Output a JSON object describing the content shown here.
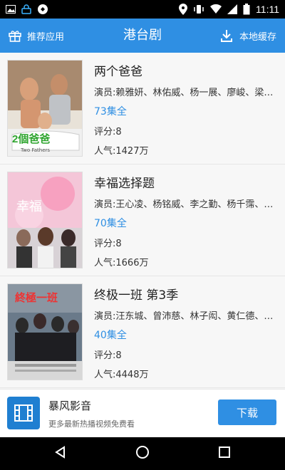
{
  "status_bar": {
    "time": "11:11",
    "icons": [
      "image-icon",
      "lock-icon",
      "do-not-disturb-icon",
      "location-icon",
      "vibrate-icon",
      "wifi-icon",
      "signal-icon",
      "battery-icon"
    ]
  },
  "app_bar": {
    "left_label": "推荐应用",
    "title": "港台剧",
    "right_label": "本地缓存"
  },
  "items": [
    {
      "title": "两个爸爸",
      "cast": "演员:赖雅妍、林佑威、杨一展、廖峻、梁…",
      "episodes": "73集全",
      "rating": "评分:8",
      "popularity": "人气:1427万",
      "poster_caption": "2個爸爸",
      "poster_sub": "Two Fathers"
    },
    {
      "title": "幸福选择题",
      "cast": "演员:王心凌、杨铭威、李之勤、杨千霈、…",
      "episodes": "70集全",
      "rating": "评分:8",
      "popularity": "人气:1666万",
      "poster_caption": "幸福",
      "poster_sub": ""
    },
    {
      "title": "终极一班 第3季",
      "cast": "演员:汪东城、曾沛慈、林子闳、黄仁德、…",
      "episodes": "40集全",
      "rating": "评分:8",
      "popularity": "人气:4448万",
      "poster_caption": "終極一班",
      "poster_sub": ""
    }
  ],
  "promo": {
    "app_name": "暴风影音",
    "description": "更多最新热播视频免费看",
    "button": "下载"
  },
  "colors": {
    "accent": "#2f8fe3",
    "promo_logo": "#1f7fd1"
  }
}
